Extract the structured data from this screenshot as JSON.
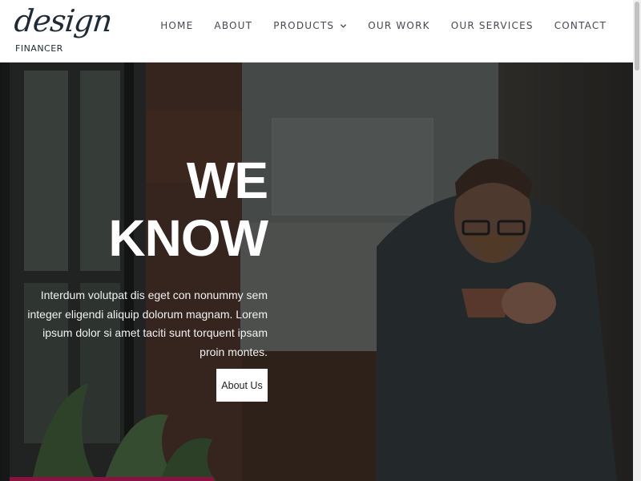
{
  "brand": {
    "logo_script": "design",
    "logo_subtitle": "FINANCER"
  },
  "nav": {
    "items": [
      {
        "label": "HOME"
      },
      {
        "label": "ABOUT"
      },
      {
        "label": "PRODUCTS",
        "has_dropdown": true
      },
      {
        "label": "OUR WORK"
      },
      {
        "label": "OUR SERVICES"
      },
      {
        "label": "CONTACT"
      }
    ],
    "dropdown_icon": "chevron-down-icon"
  },
  "hero": {
    "title_line1": "WE",
    "title_line2": "KNOW",
    "body": "Interdum volutpat dis eget con nonummy sem integer eligendi aliquip dolorum magnam. Lorem ipsum dolor si amet taciti sunt torquent ipsam proin montes.",
    "button_label": "About Us"
  },
  "colors": {
    "nav_text": "#444a52",
    "logo": "#1f2a36",
    "hero_text": "#ffffff",
    "button_bg": "#ffffff",
    "accent_strip": "#8a1240"
  }
}
